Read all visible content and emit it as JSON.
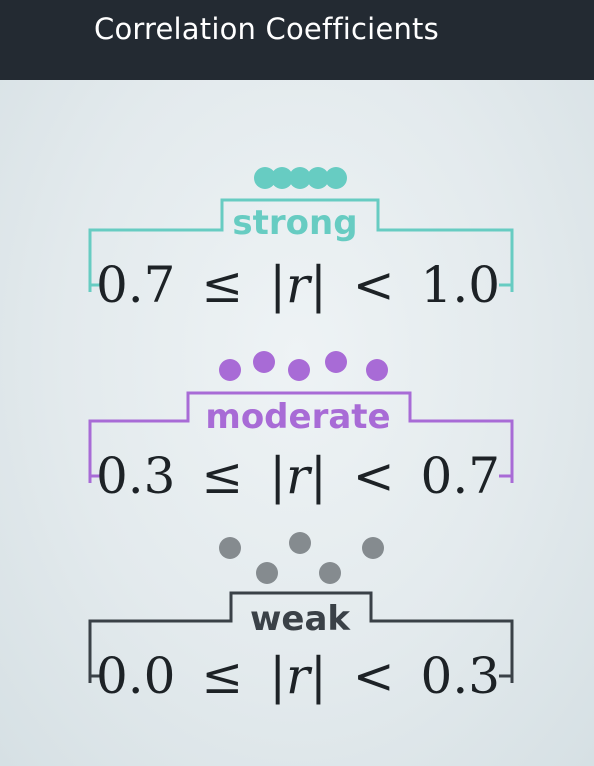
{
  "header": {
    "title": "Correlation Coefficients"
  },
  "levels": [
    {
      "label": "strong",
      "lower": "0.7",
      "upper": "1.0",
      "color": "#67ccc2",
      "dots": 5
    },
    {
      "label": "moderate",
      "lower": "0.3",
      "upper": "0.7",
      "color": "#a86bd6",
      "dots": 5
    },
    {
      "label": "weak",
      "lower": "0.0",
      "upper": "0.3",
      "color": "#858b8f",
      "dots": 5
    }
  ],
  "symbols": {
    "leq": "≤",
    "lt": "<",
    "abs_r": "|r|"
  },
  "colors": {
    "bracket_weak": "#3a4147",
    "formula": "#1d2226",
    "header_bg": "#232a32"
  }
}
